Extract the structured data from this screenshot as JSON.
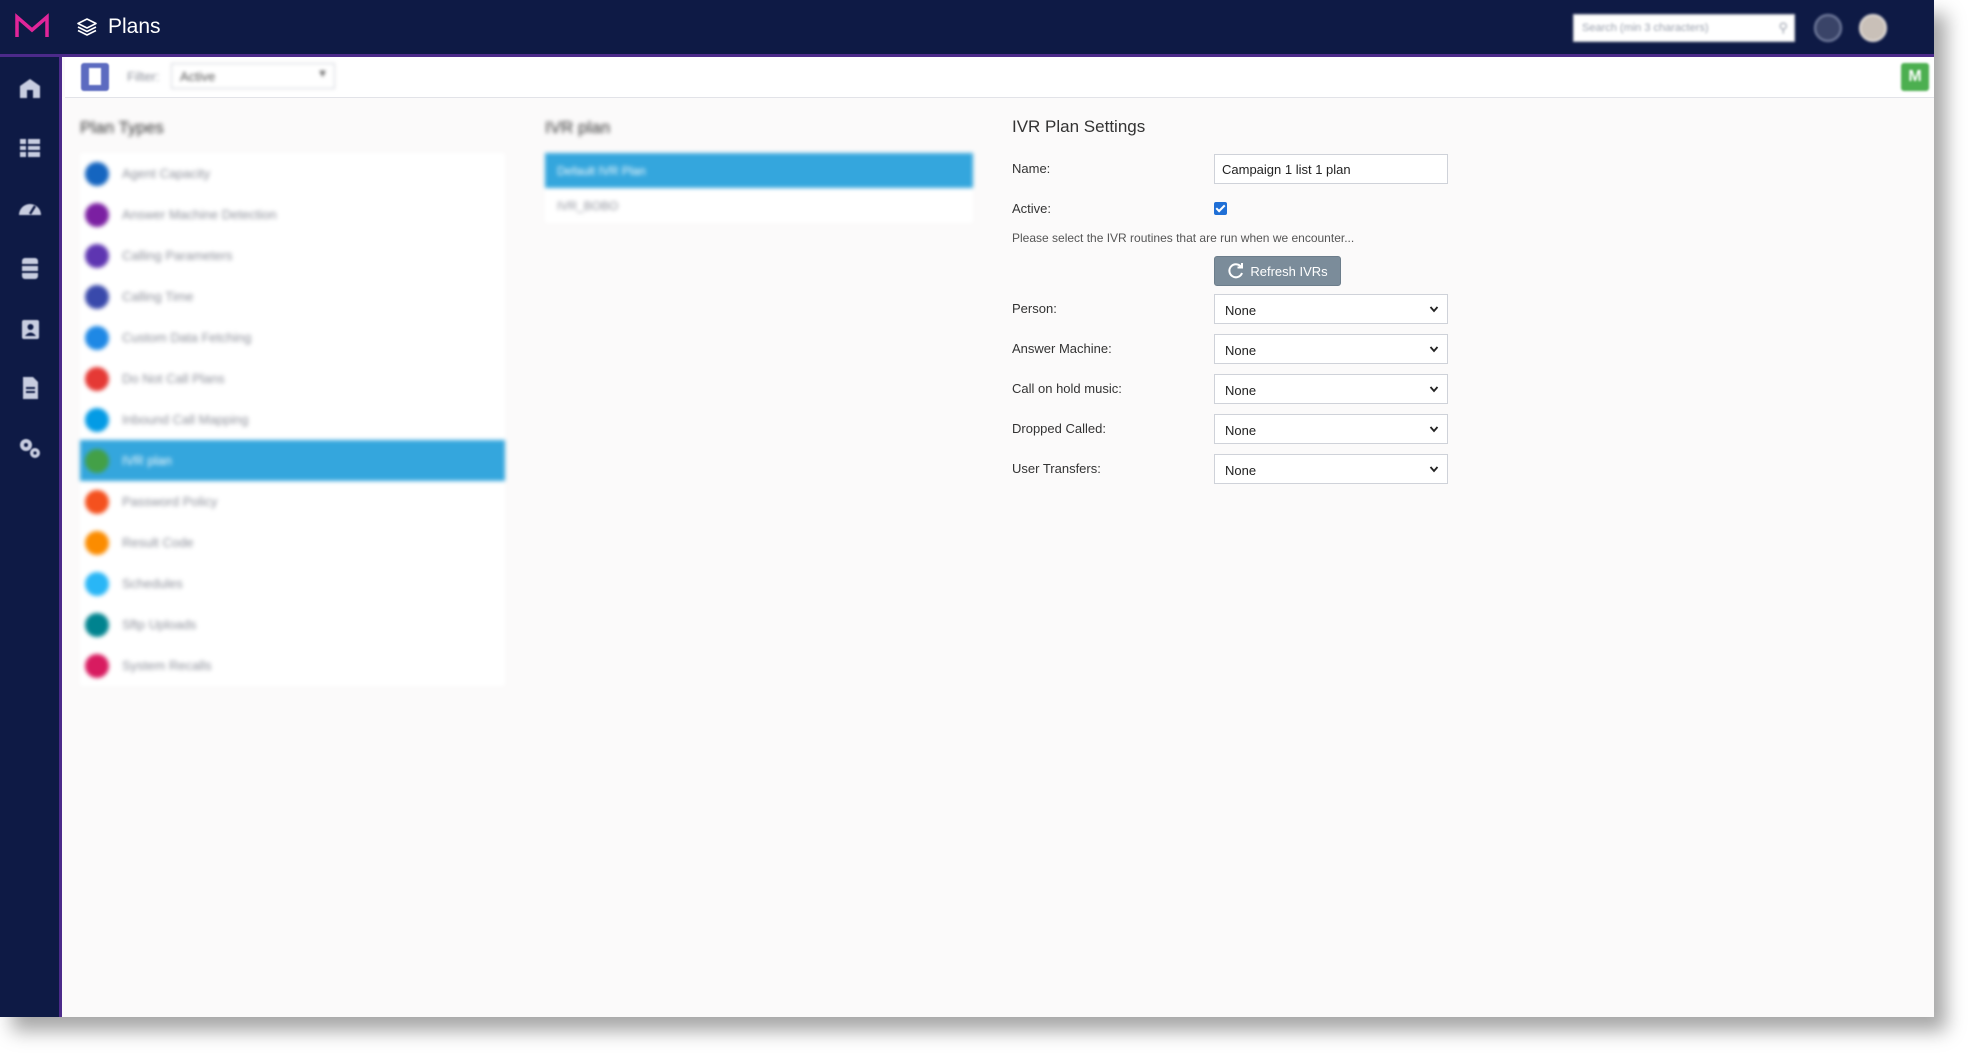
{
  "app": {
    "title": "Plans"
  },
  "topbar": {
    "search_placeholder": "Search (min 3 characters)",
    "help_icon": "help-icon",
    "avatar_icon": "avatar"
  },
  "sidebar": {
    "icons": [
      "home-icon",
      "grid-icon",
      "dashboard-icon",
      "database-icon",
      "contacts-icon",
      "document-icon",
      "settings-icon"
    ]
  },
  "toolbar": {
    "filter_label": "Filter:",
    "filter_value": "Active",
    "user_badge": "M"
  },
  "plan_types": {
    "title": "Plan Types",
    "items": [
      {
        "label": "Agent Capacity",
        "color": "#1565c0"
      },
      {
        "label": "Answer Machine Detection",
        "color": "#7b1fa2"
      },
      {
        "label": "Calling Parameters",
        "color": "#5e35b1"
      },
      {
        "label": "Calling Time",
        "color": "#3949ab"
      },
      {
        "label": "Custom Data Fetching",
        "color": "#1e88e5"
      },
      {
        "label": "Do Not Call Plans",
        "color": "#e53935"
      },
      {
        "label": "Inbound Call Mapping",
        "color": "#039be5"
      },
      {
        "label": "IVR plan",
        "color": "#43a047"
      },
      {
        "label": "Password Policy",
        "color": "#f4511e"
      },
      {
        "label": "Result Code",
        "color": "#fb8c00"
      },
      {
        "label": "Schedules",
        "color": "#29b6f6"
      },
      {
        "label": "Sftp Uploads",
        "color": "#00838f"
      },
      {
        "label": "System Recalls",
        "color": "#d81b60"
      }
    ],
    "selected_index": 7
  },
  "ivr_plan": {
    "title": "IVR plan",
    "items": [
      "Default IVR Plan",
      "IVR_BOBO"
    ],
    "selected_index": 0
  },
  "settings": {
    "title": "IVR Plan Settings",
    "name_label": "Name:",
    "name_value": "Campaign 1 list 1 plan",
    "active_label": "Active:",
    "hint": "Please select the IVR routines that are run when we encounter...",
    "refresh_label": "Refresh IVRs",
    "fields": [
      {
        "label": "Person:",
        "value": "None"
      },
      {
        "label": "Answer Machine:",
        "value": "None"
      },
      {
        "label": "Call on hold music:",
        "value": "None"
      },
      {
        "label": "Dropped Called:",
        "value": "None"
      },
      {
        "label": "User Transfers:",
        "value": "None"
      }
    ]
  }
}
